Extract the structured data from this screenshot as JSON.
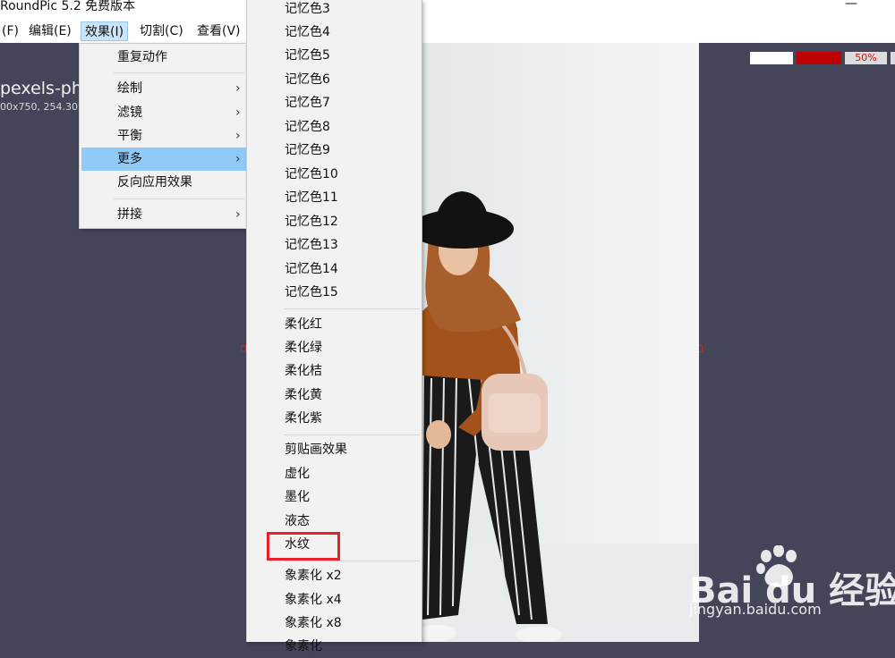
{
  "window": {
    "title": "RoundPic 5.2 免费版本",
    "minimize_glyph": "—"
  },
  "menubar": {
    "items": [
      "(F)",
      "编辑(E)",
      "效果(I)",
      "切割(C)",
      "查看(V)"
    ],
    "active_index": 2
  },
  "document": {
    "file_name": "pexels-pho",
    "file_info": "00x750, 254.30"
  },
  "zoom": {
    "label": "50%",
    "swatch_colors": [
      "#ffffff",
      "#c00000"
    ]
  },
  "effects_menu": {
    "items": [
      {
        "label": "重复动作",
        "has_submenu": false
      },
      {
        "label": "绘制",
        "has_submenu": true
      },
      {
        "label": "滤镜",
        "has_submenu": true
      },
      {
        "label": "平衡",
        "has_submenu": true
      },
      {
        "label": "更多",
        "has_submenu": true,
        "highlighted": true
      },
      {
        "label": "反向应用效果",
        "has_submenu": false
      },
      {
        "label": "拼接",
        "has_submenu": true
      }
    ],
    "arrow_glyph": "›"
  },
  "more_submenu": {
    "items": [
      "记忆色3",
      "记忆色4",
      "记忆色5",
      "记忆色6",
      "记忆色7",
      "记忆色8",
      "记忆色9",
      "记忆色10",
      "记忆色11",
      "记忆色12",
      "记忆色13",
      "记忆色14",
      "记忆色15",
      "柔化红",
      "柔化绿",
      "柔化桔",
      "柔化黄",
      "柔化紫",
      "剪贴画效果",
      "虚化",
      "墨化",
      "液态",
      "水纹",
      "象素化 x2",
      "象素化 x4",
      "象素化 x8",
      "象素化"
    ],
    "highlighted_label": "水纹",
    "highlight_color": "#e8202a"
  },
  "watermark": {
    "brand": "Bai du 经验",
    "url": "jingyan.baidu.com"
  }
}
